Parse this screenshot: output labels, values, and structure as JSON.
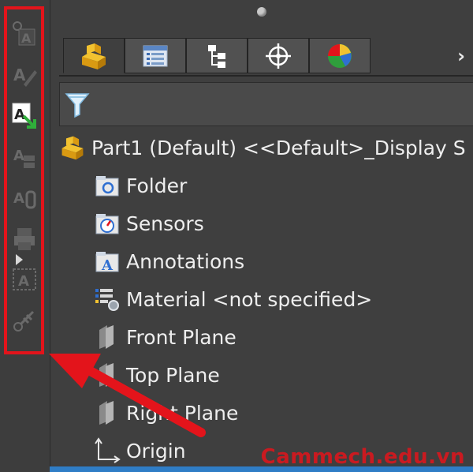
{
  "toolbar": {
    "tools": [
      {
        "name": "annotation-gear-tool-icon",
        "active": false
      },
      {
        "name": "annotation-edit-tool-icon",
        "active": false
      },
      {
        "name": "annotation-insert-tool-icon",
        "active": true
      },
      {
        "name": "annotation-stack-tool-icon",
        "active": false
      },
      {
        "name": "annotation-link-tool-icon",
        "active": false
      },
      {
        "name": "annotation-print-tool-icon",
        "active": false
      },
      {
        "name": "annotation-frame-tool-icon",
        "active": false
      },
      {
        "name": "annotation-measure-tool-icon",
        "active": false
      }
    ]
  },
  "tabs": [
    {
      "name": "feature-manager-tab-icon"
    },
    {
      "name": "property-manager-tab-icon"
    },
    {
      "name": "configuration-manager-tab-icon"
    },
    {
      "name": "dimxpert-manager-tab-icon"
    },
    {
      "name": "display-manager-tab-icon"
    }
  ],
  "tree": {
    "root_label": "Part1 (Default) <<Default>_Display S",
    "items": [
      {
        "label": "Folder",
        "icon": "folder-icon"
      },
      {
        "label": "Sensors",
        "icon": "sensors-icon"
      },
      {
        "label": "Annotations",
        "icon": "annotations-icon"
      },
      {
        "label": "Material <not specified>",
        "icon": "material-icon"
      },
      {
        "label": "Front Plane",
        "icon": "plane-icon"
      },
      {
        "label": "Top Plane",
        "icon": "plane-icon"
      },
      {
        "label": "Right Plane",
        "icon": "plane-icon"
      },
      {
        "label": "Origin",
        "icon": "origin-icon"
      }
    ]
  },
  "watermark": "Cammech.edu.vn",
  "colors": {
    "highlight": "#e3141b",
    "panel_bg": "#3f3f3f",
    "text": "#eeeeee"
  }
}
